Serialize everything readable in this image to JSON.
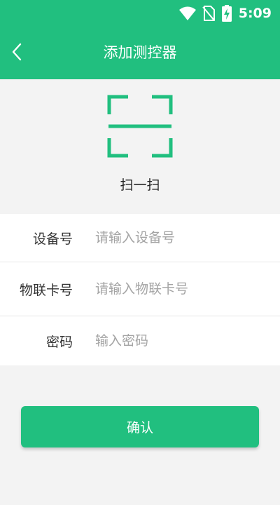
{
  "status_bar": {
    "time": "5:09",
    "icons": [
      "wifi-icon",
      "no-sim-icon",
      "battery-charging-icon"
    ]
  },
  "nav": {
    "title": "添加测控器",
    "back_icon": "chevron-left-icon"
  },
  "scan": {
    "icon": "scan-frame-icon",
    "label": "扫一扫"
  },
  "form": {
    "fields": [
      {
        "label": "设备号",
        "placeholder": "请输入设备号",
        "value": ""
      },
      {
        "label": "物联卡号",
        "placeholder": "请输入物联卡号",
        "value": ""
      },
      {
        "label": "密码",
        "placeholder": "输入密码",
        "value": ""
      }
    ]
  },
  "confirm_button": {
    "label": "确认"
  },
  "colors": {
    "primary": "#21bf7f",
    "background": "#f3f3f3",
    "placeholder": "#a4a4a4",
    "label_text": "#333333"
  }
}
